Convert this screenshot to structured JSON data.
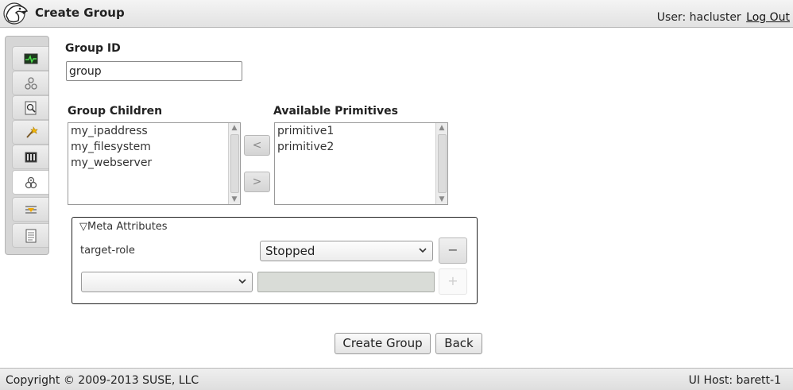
{
  "header": {
    "title": "Create Group",
    "user_prefix": "User:",
    "username": "hacluster",
    "logout_label": "Log Out"
  },
  "sidebar": {
    "items": [
      {
        "icon": "status-monitor-icon",
        "active": false
      },
      {
        "icon": "cluster-links-icon",
        "active": false
      },
      {
        "icon": "search-history-icon",
        "active": false
      },
      {
        "icon": "tools-wand-icon",
        "active": false
      },
      {
        "icon": "config-panel-icon",
        "active": false
      },
      {
        "icon": "resources-icon",
        "active": true
      },
      {
        "icon": "constraints-icon",
        "active": false
      },
      {
        "icon": "document-icon",
        "active": false
      }
    ]
  },
  "form": {
    "group_id_label": "Group ID",
    "group_id_value": "group",
    "children_label": "Group Children",
    "children": [
      "my_ipaddress",
      "my_filesystem",
      "my_webserver"
    ],
    "available_label": "Available Primitives",
    "available": [
      "primitive1",
      "primitive2"
    ],
    "move_left_label": "<",
    "move_right_label": ">"
  },
  "meta": {
    "legend": "▽Meta Attributes",
    "attr_name": "target-role",
    "attr_value": "Stopped",
    "remove_label": "−",
    "new_attr_value": "",
    "add_label": "+"
  },
  "actions": {
    "create_label": "Create Group",
    "back_label": "Back"
  },
  "footer": {
    "copyright": "Copyright © 2009-2013 SUSE, LLC",
    "host": "UI Host: barett-1"
  }
}
